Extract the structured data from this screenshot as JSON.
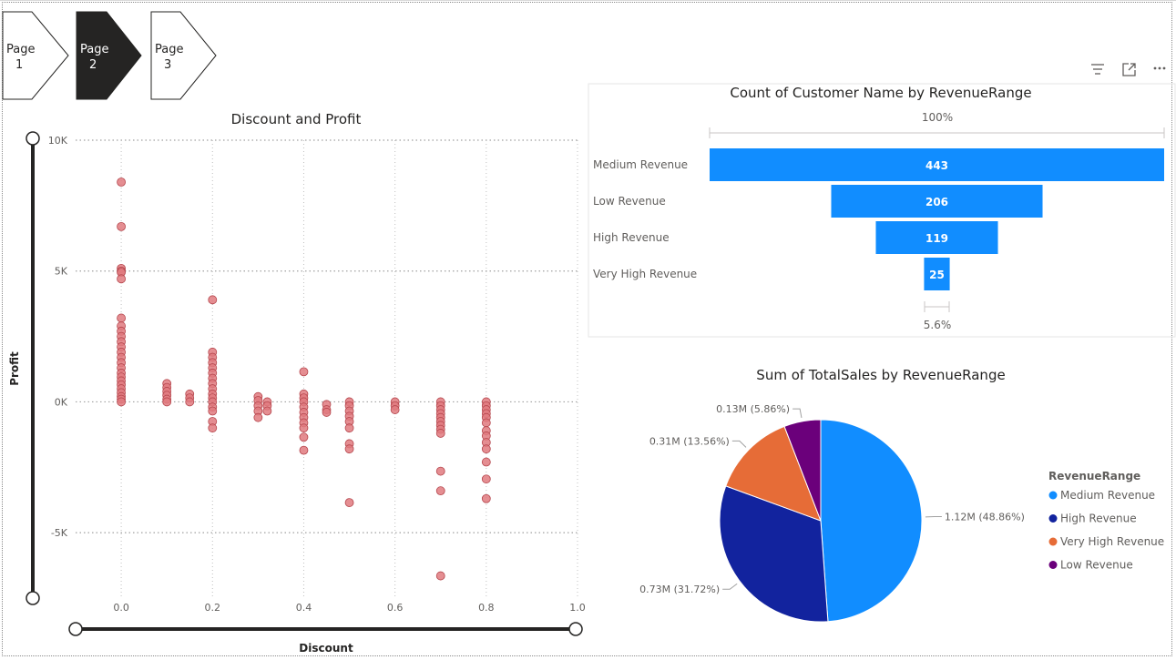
{
  "nav": {
    "pages": [
      {
        "line1": "Page",
        "line2": "1",
        "active": false
      },
      {
        "line1": "Page",
        "line2": "2",
        "active": true
      },
      {
        "line1": "Page",
        "line2": "3",
        "active": false
      }
    ]
  },
  "visual_header": {
    "icons": [
      "filter-icon",
      "focus-mode-icon",
      "more-options-icon"
    ]
  },
  "colors": {
    "scatter_fill": "#e07a7f",
    "scatter_stroke": "#b5454c",
    "funnel_bar": "#118dff",
    "medium_revenue": "#118dff",
    "high_revenue": "#12239e",
    "very_high_revenue": "#e66c37",
    "low_revenue": "#6b007b"
  },
  "chart_data": [
    {
      "type": "scatter",
      "title": "Discount and Profit",
      "xlabel": "Discount",
      "ylabel": "Profit",
      "xlim": [
        -0.1,
        1.0
      ],
      "ylim": [
        -7500,
        10000
      ],
      "xticks": [
        "0.0",
        "0.2",
        "0.4",
        "0.6",
        "0.8",
        "1.0"
      ],
      "xtick_values": [
        0,
        0.2,
        0.4,
        0.6,
        0.8,
        1.0
      ],
      "yticks": [
        "10K",
        "5K",
        "0K",
        "-5K"
      ],
      "ytick_values": [
        10000,
        5000,
        0,
        -5000
      ],
      "grid": true,
      "points": [
        [
          0,
          8400
        ],
        [
          0,
          6700
        ],
        [
          0,
          5100
        ],
        [
          0,
          5000
        ],
        [
          0,
          4950
        ],
        [
          0,
          4700
        ],
        [
          0,
          3200
        ],
        [
          0,
          2900
        ],
        [
          0,
          2700
        ],
        [
          0,
          2500
        ],
        [
          0,
          2300
        ],
        [
          0,
          2100
        ],
        [
          0,
          1900
        ],
        [
          0,
          1700
        ],
        [
          0,
          1500
        ],
        [
          0,
          1300
        ],
        [
          0,
          1100
        ],
        [
          0,
          950
        ],
        [
          0,
          800
        ],
        [
          0,
          650
        ],
        [
          0,
          500
        ],
        [
          0,
          350
        ],
        [
          0,
          200
        ],
        [
          0,
          100
        ],
        [
          0,
          0
        ],
        [
          0.1,
          700
        ],
        [
          0.1,
          550
        ],
        [
          0.1,
          400
        ],
        [
          0.1,
          250
        ],
        [
          0.1,
          100
        ],
        [
          0.1,
          0
        ],
        [
          0.15,
          300
        ],
        [
          0.15,
          150
        ],
        [
          0.15,
          0
        ],
        [
          0.2,
          3900
        ],
        [
          0.2,
          1900
        ],
        [
          0.2,
          1700
        ],
        [
          0.2,
          1500
        ],
        [
          0.2,
          1300
        ],
        [
          0.2,
          1100
        ],
        [
          0.2,
          900
        ],
        [
          0.2,
          700
        ],
        [
          0.2,
          500
        ],
        [
          0.2,
          300
        ],
        [
          0.2,
          150
        ],
        [
          0.2,
          0
        ],
        [
          0.2,
          -200
        ],
        [
          0.2,
          -350
        ],
        [
          0.2,
          -750
        ],
        [
          0.2,
          -1000
        ],
        [
          0.3,
          200
        ],
        [
          0.3,
          50
        ],
        [
          0.3,
          -150
        ],
        [
          0.3,
          -350
        ],
        [
          0.3,
          -600
        ],
        [
          0.32,
          0
        ],
        [
          0.32,
          -150
        ],
        [
          0.32,
          -350
        ],
        [
          0.4,
          1150
        ],
        [
          0.4,
          300
        ],
        [
          0.4,
          150
        ],
        [
          0.4,
          0
        ],
        [
          0.4,
          -200
        ],
        [
          0.4,
          -400
        ],
        [
          0.4,
          -600
        ],
        [
          0.4,
          -800
        ],
        [
          0.4,
          -1000
        ],
        [
          0.4,
          -1350
        ],
        [
          0.4,
          -1850
        ],
        [
          0.45,
          -100
        ],
        [
          0.45,
          -300
        ],
        [
          0.45,
          -400
        ],
        [
          0.5,
          0
        ],
        [
          0.5,
          -150
        ],
        [
          0.5,
          -350
        ],
        [
          0.5,
          -550
        ],
        [
          0.5,
          -750
        ],
        [
          0.5,
          -1000
        ],
        [
          0.5,
          -1600
        ],
        [
          0.5,
          -1800
        ],
        [
          0.5,
          -3850
        ],
        [
          0.6,
          0
        ],
        [
          0.6,
          -150
        ],
        [
          0.6,
          -300
        ],
        [
          0.7,
          0
        ],
        [
          0.7,
          -150
        ],
        [
          0.7,
          -300
        ],
        [
          0.7,
          -450
        ],
        [
          0.7,
          -600
        ],
        [
          0.7,
          -750
        ],
        [
          0.7,
          -900
        ],
        [
          0.7,
          -1050
        ],
        [
          0.7,
          -1200
        ],
        [
          0.7,
          -2650
        ],
        [
          0.7,
          -3400
        ],
        [
          0.7,
          -6650
        ],
        [
          0.8,
          0
        ],
        [
          0.8,
          -150
        ],
        [
          0.8,
          -300
        ],
        [
          0.8,
          -450
        ],
        [
          0.8,
          -600
        ],
        [
          0.8,
          -800
        ],
        [
          0.8,
          -1100
        ],
        [
          0.8,
          -1300
        ],
        [
          0.8,
          -1550
        ],
        [
          0.8,
          -1800
        ],
        [
          0.8,
          -2300
        ],
        [
          0.8,
          -2950
        ],
        [
          0.8,
          -3700
        ]
      ]
    },
    {
      "type": "funnel",
      "title": "Count of Customer Name by RevenueRange",
      "top_percent": "100%",
      "bottom_percent": "5.6%",
      "categories": [
        "Medium Revenue",
        "Low Revenue",
        "High Revenue",
        "Very High Revenue"
      ],
      "values": [
        443,
        206,
        119,
        25
      ]
    },
    {
      "type": "pie",
      "title": "Sum of TotalSales by RevenueRange",
      "legend_title": "RevenueRange",
      "legend_position": "right",
      "legend": [
        "Medium Revenue",
        "High Revenue",
        "Very High Revenue",
        "Low Revenue"
      ],
      "slices": [
        {
          "name": "Medium Revenue",
          "value": 1.12,
          "percent": 48.86,
          "label": "1.12M (48.86%)"
        },
        {
          "name": "High Revenue",
          "value": 0.73,
          "percent": 31.72,
          "label": "0.73M (31.72%)"
        },
        {
          "name": "Very High Revenue",
          "value": 0.31,
          "percent": 13.56,
          "label": "0.31M (13.56%)"
        },
        {
          "name": "Low Revenue",
          "value": 0.13,
          "percent": 5.86,
          "label": "0.13M (5.86%)"
        }
      ]
    }
  ]
}
